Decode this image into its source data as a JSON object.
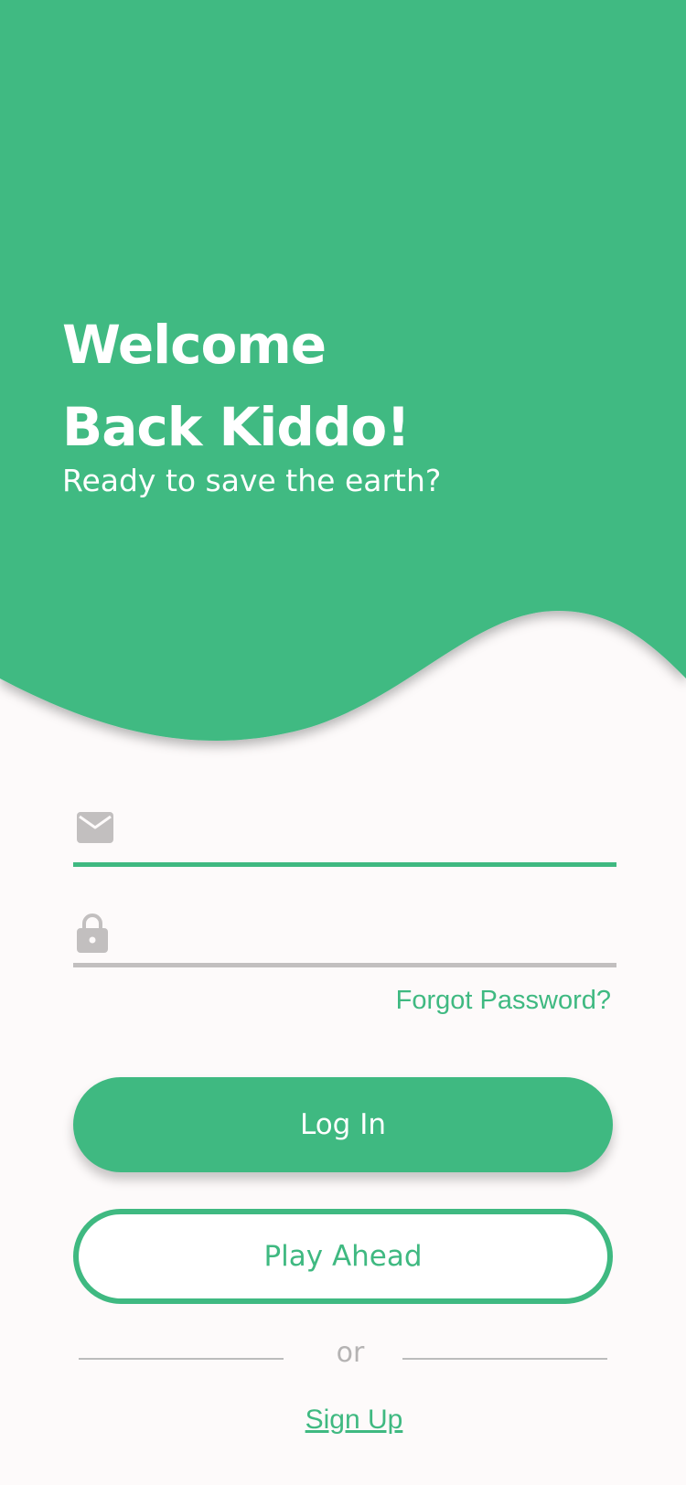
{
  "colors": {
    "accent": "#3fb981",
    "background": "#fdfafa",
    "muted": "#c2bfbf"
  },
  "hero": {
    "title_line1": "Welcome",
    "title_line2": "Back Kiddo!",
    "subtitle": "Ready to save the earth?"
  },
  "form": {
    "email": {
      "icon": "mail-icon",
      "value": "",
      "placeholder": ""
    },
    "password": {
      "icon": "lock-icon",
      "value": "",
      "placeholder": ""
    },
    "forgot_label": "Forgot Password?"
  },
  "actions": {
    "login_label": "Log In",
    "play_label": "Play Ahead",
    "or_label": "or",
    "signup_label": "Sign Up"
  }
}
